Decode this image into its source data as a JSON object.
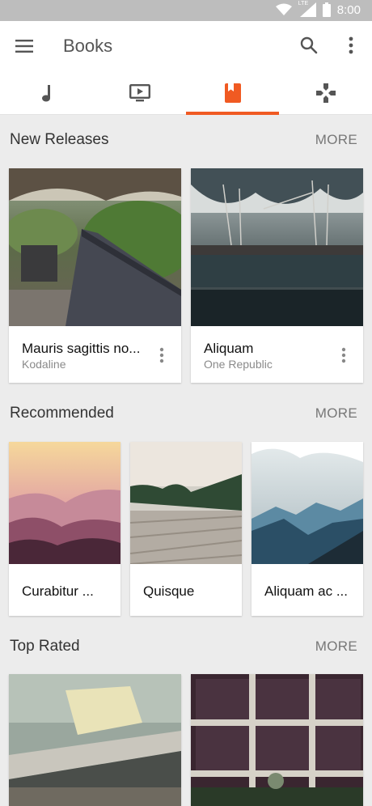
{
  "status": {
    "time": "8:00",
    "network": "LTE"
  },
  "app_bar": {
    "title": "Books",
    "menu_icon": "hamburger-menu-icon",
    "search_icon": "search-icon",
    "overflow_icon": "more-vert-icon"
  },
  "tabs": [
    {
      "icon": "music-note-icon",
      "active": false
    },
    {
      "icon": "tv-play-icon",
      "active": false
    },
    {
      "icon": "book-icon",
      "active": true
    },
    {
      "icon": "gamepad-icon",
      "active": false
    }
  ],
  "colors": {
    "accent": "#f05a22",
    "tab_icon": "#555555"
  },
  "sections": {
    "new_releases": {
      "title": "New Releases",
      "more": "MORE",
      "items": [
        {
          "title": "Mauris sagittis no...",
          "subtitle": "Kodaline"
        },
        {
          "title": "Aliquam",
          "subtitle": "One Republic"
        }
      ]
    },
    "recommended": {
      "title": "Recommended",
      "more": "MORE",
      "items": [
        {
          "title": "Curabitur ..."
        },
        {
          "title": "Quisque"
        },
        {
          "title": "Aliquam ac ..."
        }
      ]
    },
    "top_rated": {
      "title": "Top Rated",
      "more": "MORE"
    }
  }
}
